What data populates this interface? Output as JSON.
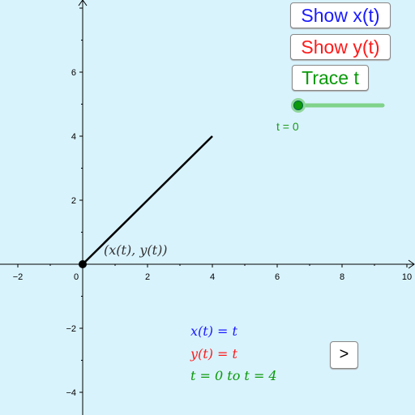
{
  "buttons": {
    "show_x": "Show x(t)",
    "show_y": "Show y(t)",
    "trace": "Trace t",
    "next": ">"
  },
  "colors": {
    "x": "#1a1aff",
    "y": "#ff1a1a",
    "t": "#0a9a0a",
    "background": "#d9f3fd"
  },
  "slider": {
    "label": "t = 0",
    "value": 0,
    "min": 0,
    "max": 4
  },
  "point_label": "(x(t), y(t))",
  "equations": {
    "x": "x(t) = t",
    "y": "y(t) = t",
    "range": "t = 0 to t = 4"
  },
  "axes": {
    "xlim": [
      -2.5,
      10.2
    ],
    "ylim": [
      -4.6,
      8.2
    ],
    "x_ticks": [
      "−2",
      "0",
      "2",
      "4",
      "6",
      "8",
      "10"
    ],
    "y_ticks": [
      "−4",
      "−2",
      "2",
      "4",
      "6"
    ]
  },
  "segment": {
    "from": [
      0,
      0
    ],
    "to": [
      4,
      4
    ]
  }
}
